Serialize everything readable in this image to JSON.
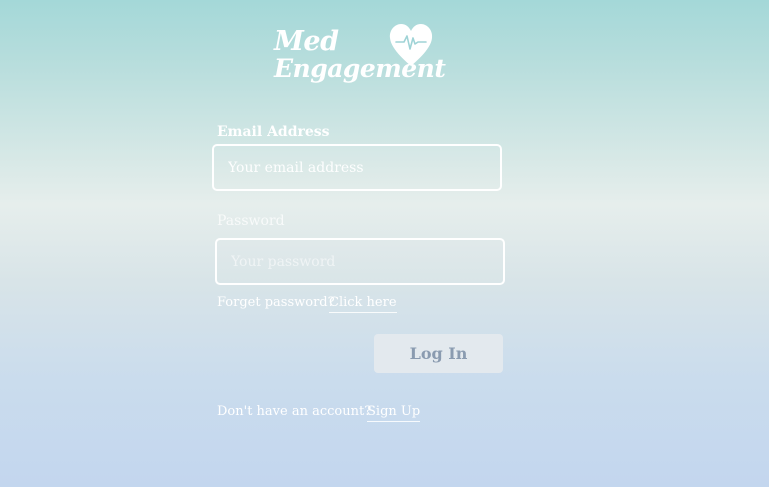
{
  "logo": {
    "line1": "Med",
    "line2": "Engagement",
    "heart_icon": "heart-pulse-icon"
  },
  "form": {
    "email_label": "Email Address",
    "email_placeholder": "Your email address",
    "email_value": "",
    "password_label": "Password",
    "password_placeholder": "Your password",
    "password_value": "",
    "forgot_text": "Forget password?",
    "forgot_link": "Click here",
    "login_label": "Log In",
    "signup_text": "Don't have an account?",
    "signup_link": "Sign Up"
  },
  "colors": {
    "text": "#ffffff",
    "button_bg": "#e3e9ee",
    "button_text": "#8a9bb0",
    "heart_line": "#9fd3d6",
    "bg_top": "#a4d8d8",
    "bg_middle": "#e6eeec",
    "bg_bottom": "#c3d6ee"
  }
}
